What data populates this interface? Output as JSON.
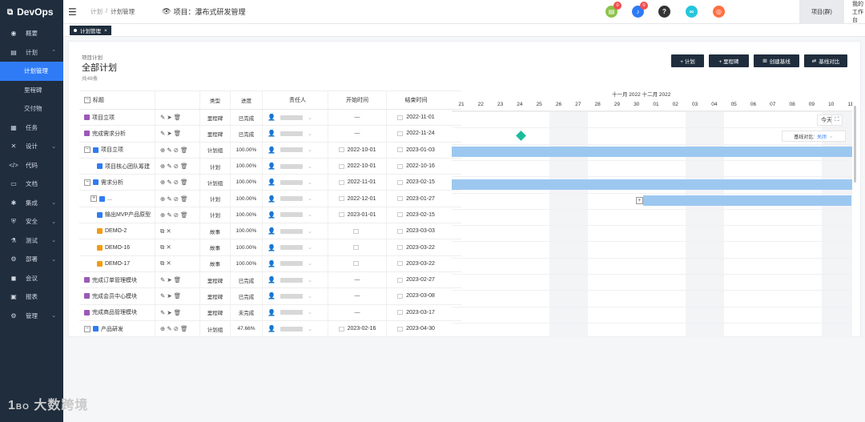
{
  "app": {
    "logo_text": "DevOps"
  },
  "sidebar": {
    "items": [
      {
        "label": "概要",
        "icon": "dashboard-icon",
        "glyph": "◉"
      },
      {
        "label": "计划",
        "icon": "plan-icon",
        "glyph": "▤",
        "expanded": true
      },
      {
        "label": "计划管理",
        "sub": true,
        "active": true
      },
      {
        "label": "里程碑",
        "sub": true
      },
      {
        "label": "交付物",
        "sub": true
      },
      {
        "label": "任务",
        "icon": "task-icon",
        "glyph": "▦"
      },
      {
        "label": "设计",
        "icon": "design-icon",
        "glyph": "✕",
        "chev": true
      },
      {
        "label": "代码",
        "icon": "code-icon",
        "glyph": "</>"
      },
      {
        "label": "文档",
        "icon": "doc-icon",
        "glyph": "▭"
      },
      {
        "label": "集成",
        "icon": "integration-icon",
        "glyph": "✱",
        "chev": true
      },
      {
        "label": "安全",
        "icon": "security-icon",
        "glyph": "⛨",
        "chev": true
      },
      {
        "label": "测试",
        "icon": "test-icon",
        "glyph": "⚗",
        "chev": true
      },
      {
        "label": "部署",
        "icon": "deploy-icon",
        "glyph": "⚙",
        "chev": true
      },
      {
        "label": "会议",
        "icon": "meeting-icon",
        "glyph": "◼"
      },
      {
        "label": "报表",
        "icon": "report-icon",
        "glyph": "▣"
      },
      {
        "label": "管理",
        "icon": "admin-icon",
        "glyph": "⚙",
        "chev": true
      }
    ]
  },
  "header": {
    "breadcrumb_root": "计划",
    "breadcrumb_sep": "/",
    "breadcrumb_current": "计划管理",
    "project_label": "项目：瀑布式研发管理",
    "notif_count_1": "0",
    "notif_count_2": "0",
    "project_tab": "项目(群)",
    "my_work": "我的工作台",
    "user_name": "赵"
  },
  "tabstrip": {
    "tab_label": "计划管理",
    "tab_close": "×"
  },
  "page": {
    "title_small": "项目计划",
    "title": "全部计划",
    "count": "共48条",
    "buttons": {
      "add_plan": "+ 计划",
      "add_milestone": "+ 里程碑",
      "create_baseline": "创建基线",
      "compare_baseline": "基线对比"
    }
  },
  "table": {
    "headers": {
      "title": "标题",
      "type": "类型",
      "progress": "进度",
      "owner": "责任人",
      "start": "开始时间",
      "end": "结束时间"
    },
    "rows": [
      {
        "title": "项目立项",
        "kind": "ms",
        "level": 0,
        "expand": "",
        "actions": "✎ ➤ 🗑",
        "type": "里程碑",
        "progress": "已完成",
        "start": "—",
        "end": "2022-11-01",
        "start_cal": false
      },
      {
        "title": "完成需求分析",
        "kind": "ms",
        "level": 0,
        "expand": "",
        "actions": "✎ ➤ 🗑",
        "type": "里程碑",
        "progress": "已完成",
        "start": "—",
        "end": "2022-11-24",
        "start_cal": false
      },
      {
        "title": "项目立项",
        "kind": "pl",
        "level": 0,
        "expand": "−",
        "actions": "⊕ ✎ ⊘ 🗑",
        "type": "计划组",
        "progress": "100.00%",
        "start": "2022-10-01",
        "end": "2023-01-03",
        "start_cal": true
      },
      {
        "title": "项目核心团队筹建",
        "kind": "pl",
        "level": 1,
        "expand": "",
        "actions": "⊕ ✎ ⊘ 🗑",
        "type": "计划",
        "progress": "100.00%",
        "start": "2022-10-01",
        "end": "2022-10-16",
        "start_cal": true
      },
      {
        "title": "需求分析",
        "kind": "pl",
        "level": 0,
        "expand": "−",
        "actions": "⊕ ✎ ⊘ 🗑",
        "type": "计划组",
        "progress": "100.00%",
        "start": "2022-11-01",
        "end": "2023-02-15",
        "start_cal": true
      },
      {
        "title": "...",
        "kind": "pl",
        "level": 1,
        "expand": "+",
        "actions": "⊕ ✎ ⊘ 🗑",
        "type": "计划",
        "progress": "100.00%",
        "start": "2022-12-01",
        "end": "2023-01-27",
        "start_cal": true
      },
      {
        "title": "输出MVP产品原型",
        "kind": "pl",
        "level": 1,
        "expand": "",
        "actions": "⊕ ✎ ⊘ 🗑",
        "type": "计划",
        "progress": "100.00%",
        "start": "2023-01-01",
        "end": "2023-02-15",
        "start_cal": true
      },
      {
        "title": "DEMO-2",
        "kind": "st",
        "level": 1,
        "expand": "",
        "actions": "⧉ ✕",
        "type": "故事",
        "progress": "100.00%",
        "start": "",
        "end": "2023-03-03",
        "start_cal": true
      },
      {
        "title": "DEMO-16",
        "kind": "st",
        "level": 1,
        "expand": "",
        "actions": "⧉ ✕",
        "type": "故事",
        "progress": "100.00%",
        "start": "",
        "end": "2023-03-22",
        "start_cal": true
      },
      {
        "title": "DEMO-17",
        "kind": "st",
        "level": 1,
        "expand": "",
        "actions": "⧉ ✕",
        "type": "故事",
        "progress": "100.00%",
        "start": "",
        "end": "2023-03-22",
        "start_cal": true
      },
      {
        "title": "完成订单管理模块",
        "kind": "ms",
        "level": 0,
        "expand": "",
        "actions": "✎ ➤ 🗑",
        "type": "里程碑",
        "progress": "已完成",
        "start": "—",
        "end": "2023-02-27",
        "start_cal": false
      },
      {
        "title": "完成会员中心模块",
        "kind": "ms",
        "level": 0,
        "expand": "",
        "actions": "✎ ➤ 🗑",
        "type": "里程碑",
        "progress": "已完成",
        "start": "—",
        "end": "2023-03-08",
        "start_cal": false
      },
      {
        "title": "完成商品管理模块",
        "kind": "ms",
        "level": 0,
        "expand": "",
        "actions": "✎ ➤ 🗑",
        "type": "里程碑",
        "progress": "未完成",
        "start": "—",
        "end": "2023-03-17",
        "start_cal": false
      },
      {
        "title": "产品研发",
        "kind": "pl",
        "level": 0,
        "expand": "−",
        "actions": "⊕ ✎ ⊘ 🗑",
        "type": "计划组",
        "progress": "47.66%",
        "start": "2023-02-16",
        "end": "2023-04-30",
        "start_cal": true
      }
    ]
  },
  "gantt": {
    "month_label": "十一月 2022 十二月 2022",
    "days": [
      "21",
      "22",
      "23",
      "24",
      "25",
      "26",
      "27",
      "28",
      "29",
      "30",
      "01",
      "02",
      "03",
      "04",
      "05",
      "06",
      "07",
      "08",
      "09",
      "10",
      "11"
    ],
    "weekend_indices": [
      5,
      6,
      12,
      13,
      19,
      20
    ],
    "today_label": "今天",
    "fullscreen_icon": "⛶",
    "baseline_label": "基线对比:",
    "baseline_value": "关闭"
  },
  "watermark": "大数跨境"
}
